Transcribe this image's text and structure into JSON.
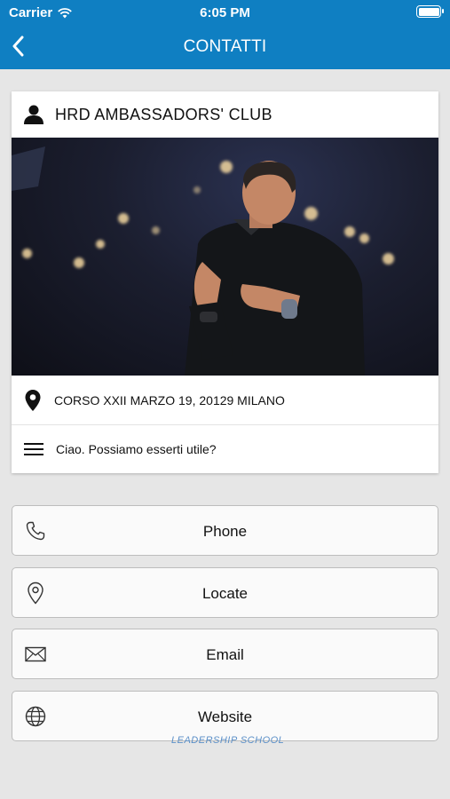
{
  "status_bar": {
    "carrier": "Carrier",
    "time": "6:05 PM"
  },
  "nav": {
    "title": "CONTATTI"
  },
  "card": {
    "title": "HRD AMBASSADORS' CLUB",
    "address": "CORSO XXII MARZO 19, 20129 MILANO",
    "message": "Ciao. Possiamo esserti utile?"
  },
  "actions": [
    {
      "label": "Phone",
      "icon": "phone-icon"
    },
    {
      "label": "Locate",
      "icon": "location-pin-icon"
    },
    {
      "label": "Email",
      "icon": "envelope-icon"
    },
    {
      "label": "Website",
      "icon": "globe-icon"
    }
  ],
  "footer": {
    "logo_text": "LEADERSHIP SCHOOL"
  },
  "colors": {
    "header": "#0f7fc2",
    "background": "#e6e6e6"
  }
}
